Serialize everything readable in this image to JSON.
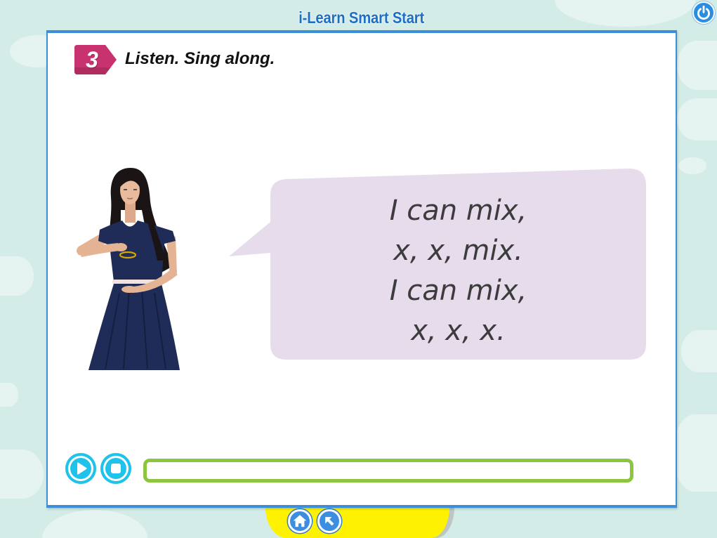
{
  "app": {
    "title": "i-Learn Smart Start",
    "power_icon": "power-icon"
  },
  "activity": {
    "number": "3",
    "instruction": "Listen. Sing along."
  },
  "song": {
    "lines": [
      "I can mix,",
      "x, x, mix.",
      "I can mix,",
      "x, x, x."
    ]
  },
  "player": {
    "play_icon": "play-icon",
    "stop_icon": "stop-icon",
    "progress": 0
  },
  "footer": {
    "home_icon": "home-icon",
    "back_icon": "back-arrow-icon"
  },
  "colors": {
    "background": "#d4ece7",
    "cloud": "#e5f4f1",
    "title": "#1d6fc4",
    "power_button": "#2b8de2",
    "panel_border": "#3b8fd9",
    "badge": "#c8326e",
    "bubble": "#e6dcec",
    "song_text": "#3c3c3c",
    "player_button": "#1ec2ea",
    "progress_border": "#8cc63f",
    "footer_tab": "#fff200",
    "footer_button": "#3d8de0"
  }
}
